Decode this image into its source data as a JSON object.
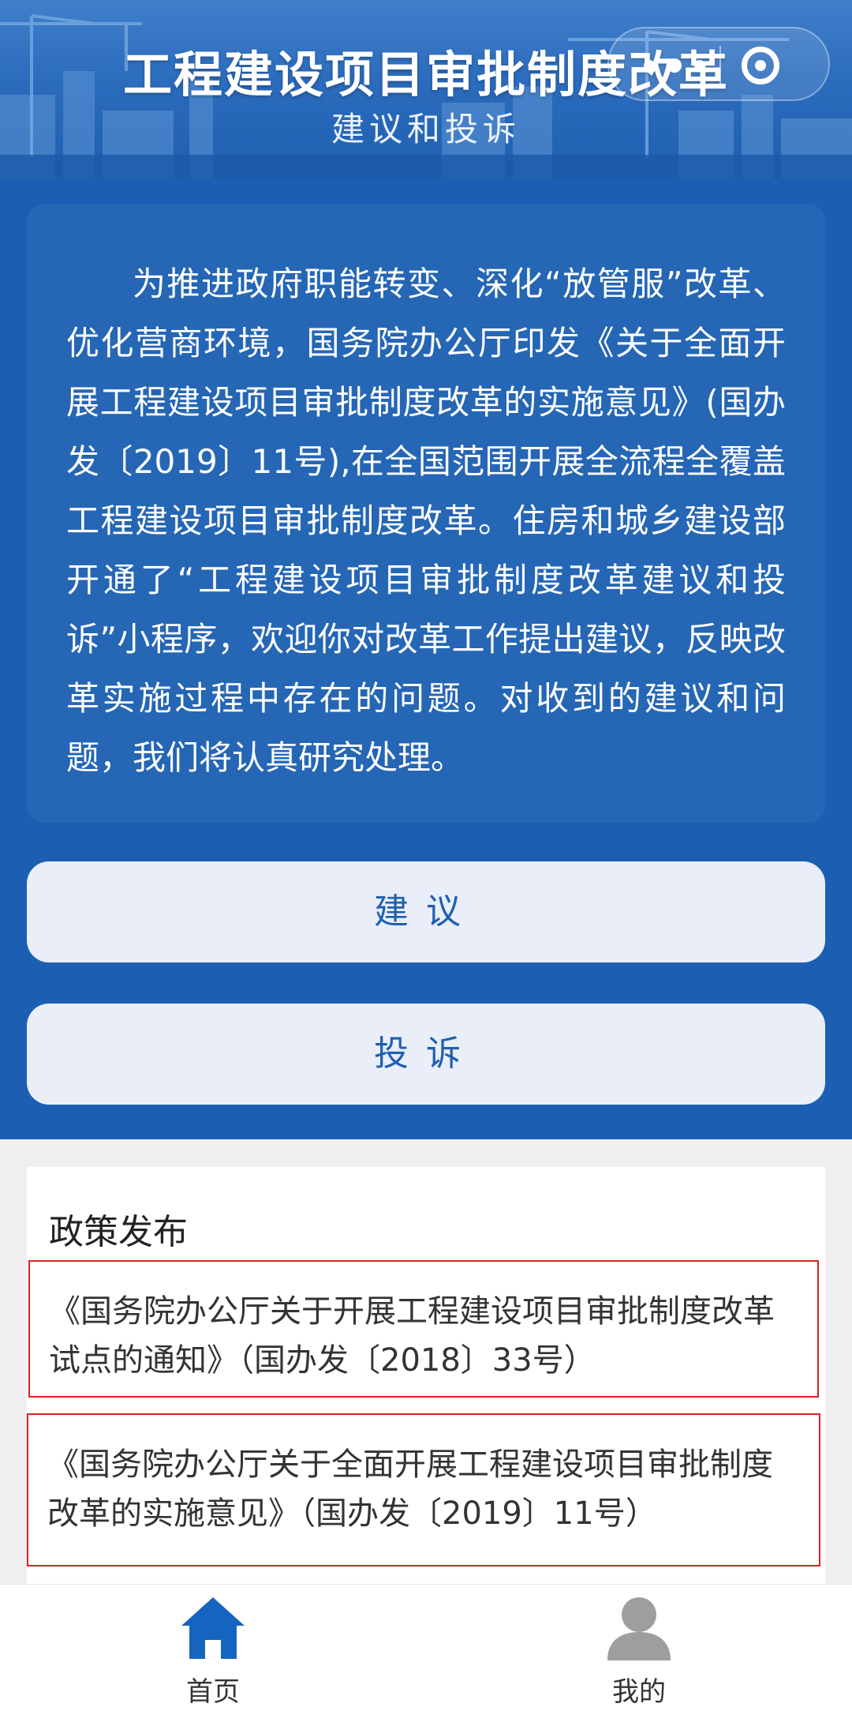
{
  "header": {
    "title": "工程建设项目审批制度改革",
    "subtitle": "建议和投诉"
  },
  "intro": {
    "text": "为推进政府职能转变、深化“放管服”改革、优化营商环境，国务院办公厅印发《关于全面开展工程建设项目审批制度改革的实施意见》(国办发〔2019〕11号),在全国范围开展全流程全覆盖工程建设项目审批制度改革。住房和城乡建设部开通了“工程建设项目审批制度改革建议和投诉”小程序，欢迎你对改革工作提出建议，反映改革实施过程中存在的问题。对收到的建议和问题，我们将认真研究处理。"
  },
  "actions": {
    "suggest_label": "建议",
    "complain_label": "投诉"
  },
  "policy": {
    "title": "政策发布",
    "items": [
      "《国务院办公厅关于开展工程建设项目审批制度改革试点的通知》（国办发〔2018〕33号）",
      "《国务院办公厅关于全面开展工程建设项目审批制度改革的实施意见》（国办发〔2019〕11号）"
    ]
  },
  "tabbar": {
    "tabs": [
      {
        "label": "首页",
        "icon": "home-icon",
        "active": true
      },
      {
        "label": "我的",
        "icon": "user-icon",
        "active": false
      }
    ]
  },
  "colors": {
    "primary_blue": "#1c5fb2",
    "card_blue": "#2566b5",
    "button_bg": "#e9eef8",
    "highlight_red": "#e02020",
    "home_icon_blue": "#1565c0",
    "user_icon_gray": "#9e9e9e"
  }
}
